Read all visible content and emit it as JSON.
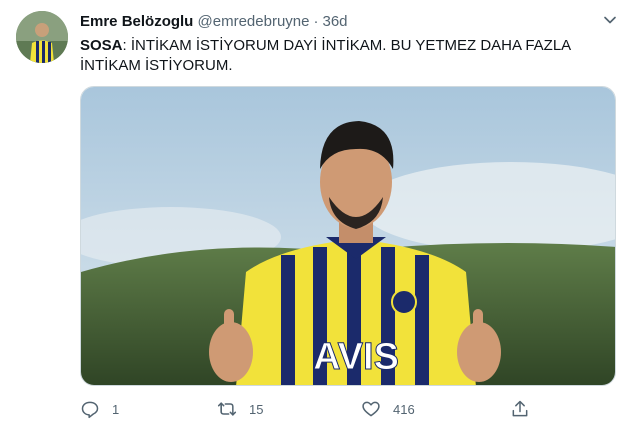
{
  "tweet": {
    "author_name": "Emre Belözoglu",
    "author_handle": "@emredebruyne",
    "separator": "·",
    "time": "36d",
    "mention": "SOSA",
    "body_text": ": İNTİKAM İSTİYORUM DAYİ İNTİKAM. BU YETMEZ DAHA FAZLA İNTİKAM İSTİYORUM.",
    "media_sponsor_text": "AVIS",
    "reply_count": "1",
    "retweet_count": "15",
    "like_count": "416"
  },
  "colors": {
    "text_primary": "#0f1419",
    "text_secondary": "#536471",
    "jersey_navy": "#1b2a6b",
    "jersey_yellow": "#f2e23a",
    "sky": "#c9dcea",
    "hill": "#4f6a3d"
  },
  "icons": [
    "chevron-down-icon",
    "reply-icon",
    "retweet-icon",
    "like-icon",
    "share-icon"
  ]
}
